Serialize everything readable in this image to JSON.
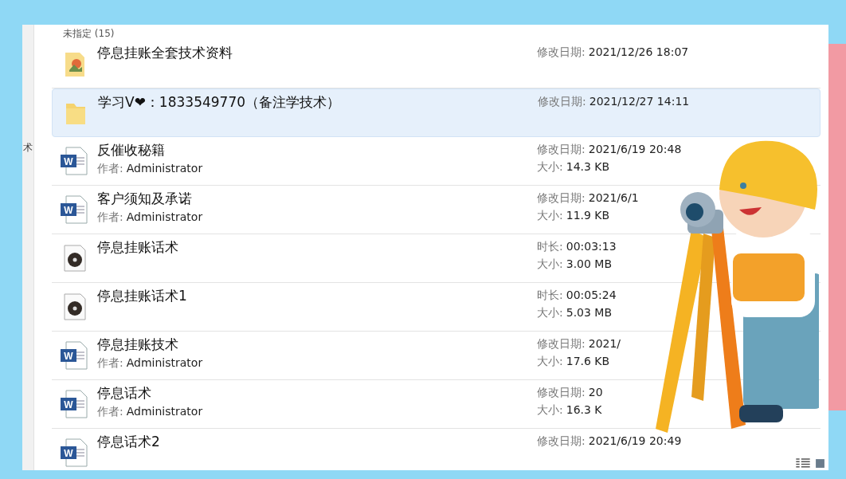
{
  "sidebar": {
    "fragment": "术"
  },
  "group": {
    "label": "未指定 (15)"
  },
  "items": [
    {
      "name": "停息挂账全套技术资料",
      "kind": "image-folder",
      "selected": false,
      "details": [
        {
          "label": "修改日期:",
          "value": "2021/12/26 18:07"
        }
      ]
    },
    {
      "name": "学习V❤：1833549770（备注学技术）",
      "kind": "folder",
      "selected": true,
      "details": [
        {
          "label": "修改日期:",
          "value": "2021/12/27 14:11"
        }
      ]
    },
    {
      "name": "反催收秘籍",
      "kind": "word",
      "badge": "W",
      "selected": false,
      "author": {
        "label": "作者:",
        "value": "Administrator"
      },
      "details": [
        {
          "label": "修改日期:",
          "value": "2021/6/19 20:48"
        },
        {
          "label": "大小:",
          "value": "14.3 KB"
        }
      ]
    },
    {
      "name": "客户须知及承诺",
      "kind": "word",
      "badge": "W",
      "selected": false,
      "author": {
        "label": "作者:",
        "value": "Administrator"
      },
      "details": [
        {
          "label": "修改日期:",
          "value": "2021/6/1"
        },
        {
          "label": "大小:",
          "value": "11.9 KB"
        }
      ]
    },
    {
      "name": "停息挂账话术",
      "kind": "audio",
      "selected": false,
      "details": [
        {
          "label": "时长:",
          "value": "00:03:13"
        },
        {
          "label": "大小:",
          "value": "3.00 MB"
        }
      ]
    },
    {
      "name": "停息挂账话术1",
      "kind": "audio",
      "selected": false,
      "details": [
        {
          "label": "时长:",
          "value": "00:05:24"
        },
        {
          "label": "大小:",
          "value": "5.03 MB"
        }
      ]
    },
    {
      "name": "停息挂账技术",
      "kind": "word",
      "badge": "W",
      "selected": false,
      "author": {
        "label": "作者:",
        "value": "Administrator"
      },
      "details": [
        {
          "label": "修改日期:",
          "value": "2021/"
        },
        {
          "label": "大小:",
          "value": "17.6 KB"
        }
      ]
    },
    {
      "name": "停息话术",
      "kind": "word",
      "badge": "W",
      "selected": false,
      "author": {
        "label": "作者:",
        "value": "Administrator"
      },
      "details": [
        {
          "label": "修改日期:",
          "value": "20"
        },
        {
          "label": "大小:",
          "value": "16.3 K"
        }
      ]
    },
    {
      "name": "停息话术2",
      "kind": "word",
      "badge": "W",
      "selected": false,
      "details": [
        {
          "label": "修改日期:",
          "value": "2021/6/19 20:49"
        }
      ]
    }
  ]
}
